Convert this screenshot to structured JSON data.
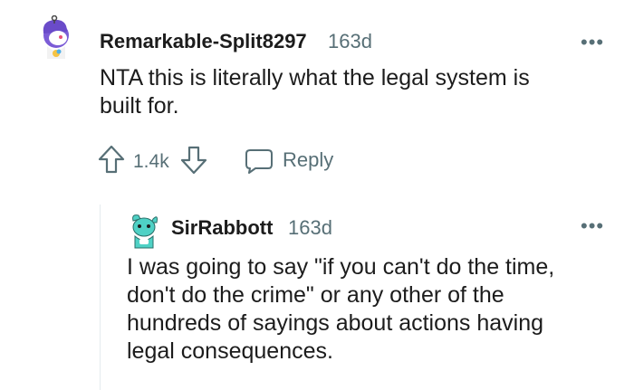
{
  "comment": {
    "username": "Remarkable-Split8297",
    "age": "163d",
    "text_line1": "NTA this is literally what the legal system is",
    "text_line2": "built for.",
    "votes": "1.4k",
    "reply_label": "Reply",
    "more_label": "•••"
  },
  "reply": {
    "username": "SirRabbott",
    "age": "163d",
    "text_line1": "I was going to say \"if you can't do the time,",
    "text_line2": "don't do the crime\" or any other of the",
    "text_line3": "hundreds of sayings about actions having",
    "text_line4": "legal consequences.",
    "more_label": "•••"
  },
  "colors": {
    "text": "#1c1c1c",
    "meta": "#576f76",
    "avatar1_hair": "#7b5cd6",
    "avatar2_body": "#4fd1c5"
  }
}
